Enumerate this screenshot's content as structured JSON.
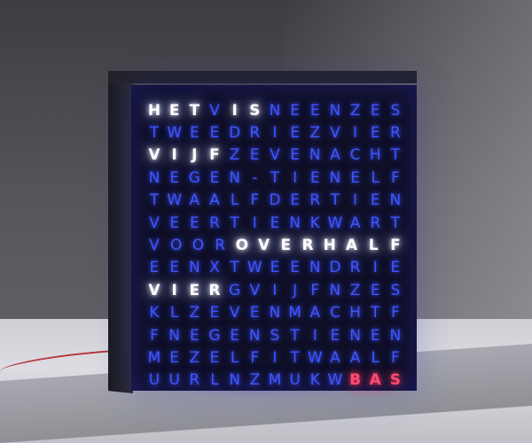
{
  "clock": {
    "rows": [
      "HETVISNEENZES",
      "TWEEDRIEZVIER",
      "VIJFZEVENACHT",
      "NEGEN-TIENELF",
      "TWAALFDERTIEN",
      "VEERTIENKWART",
      "VOOROVERHALF",
      "EENXTWEENDRIE",
      "VIERGVIJFNZES",
      "KLZEVENMACHTF",
      "FNEGENSTIENEN",
      "MEZELFITWAALF",
      "UURLNZMUKWBAS"
    ],
    "lit_words": [
      "HET",
      "IS",
      "VIJF",
      "OVER",
      "HALF",
      "VIER"
    ],
    "red_word": "BAS",
    "colors": {
      "unlit": "#3f55ff",
      "lit": "#ffffff",
      "red": "#ff4a70"
    }
  }
}
